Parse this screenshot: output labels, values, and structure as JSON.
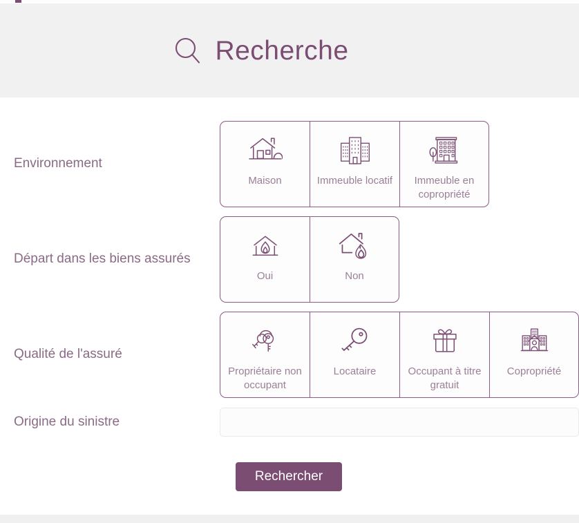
{
  "header": {
    "icon": "search-icon",
    "title": "Recherche"
  },
  "form": {
    "rows": [
      {
        "label": "Environnement",
        "name": "environnement",
        "options": [
          {
            "label": "Maison",
            "icon": "house-icon"
          },
          {
            "label": "Immeuble locatif",
            "icon": "apartment-buildings-icon"
          },
          {
            "label": "Immeuble en copropriété",
            "icon": "building-with-tree-icon"
          }
        ]
      },
      {
        "label": "Départ dans les biens assurés",
        "name": "depart-biens-assures",
        "options": [
          {
            "label": "Oui",
            "icon": "house-fire-inside-icon"
          },
          {
            "label": "Non",
            "icon": "house-fire-outside-icon"
          }
        ]
      },
      {
        "label": "Qualité de l'assuré",
        "name": "qualite-assure",
        "options": [
          {
            "label": "Propriétaire non occupant",
            "icon": "keyring-icon"
          },
          {
            "label": "Locataire",
            "icon": "key-icon"
          },
          {
            "label": "Occupant à titre gratuit",
            "icon": "gift-icon"
          },
          {
            "label": "Copropriété",
            "icon": "buildings-person-icon"
          }
        ]
      }
    ],
    "origin": {
      "label": "Origine du sinistre",
      "value": "",
      "placeholder": ""
    },
    "submit_label": "Rechercher"
  },
  "colors": {
    "accent": "#7b4d73",
    "card_border": "#8b5a87",
    "label_text": "#8a6a85",
    "option_text": "#9b7f96",
    "header_bg": "#f1f1f1",
    "footer_bg": "#f0f0f0",
    "input_border": "#e9e9e9"
  }
}
